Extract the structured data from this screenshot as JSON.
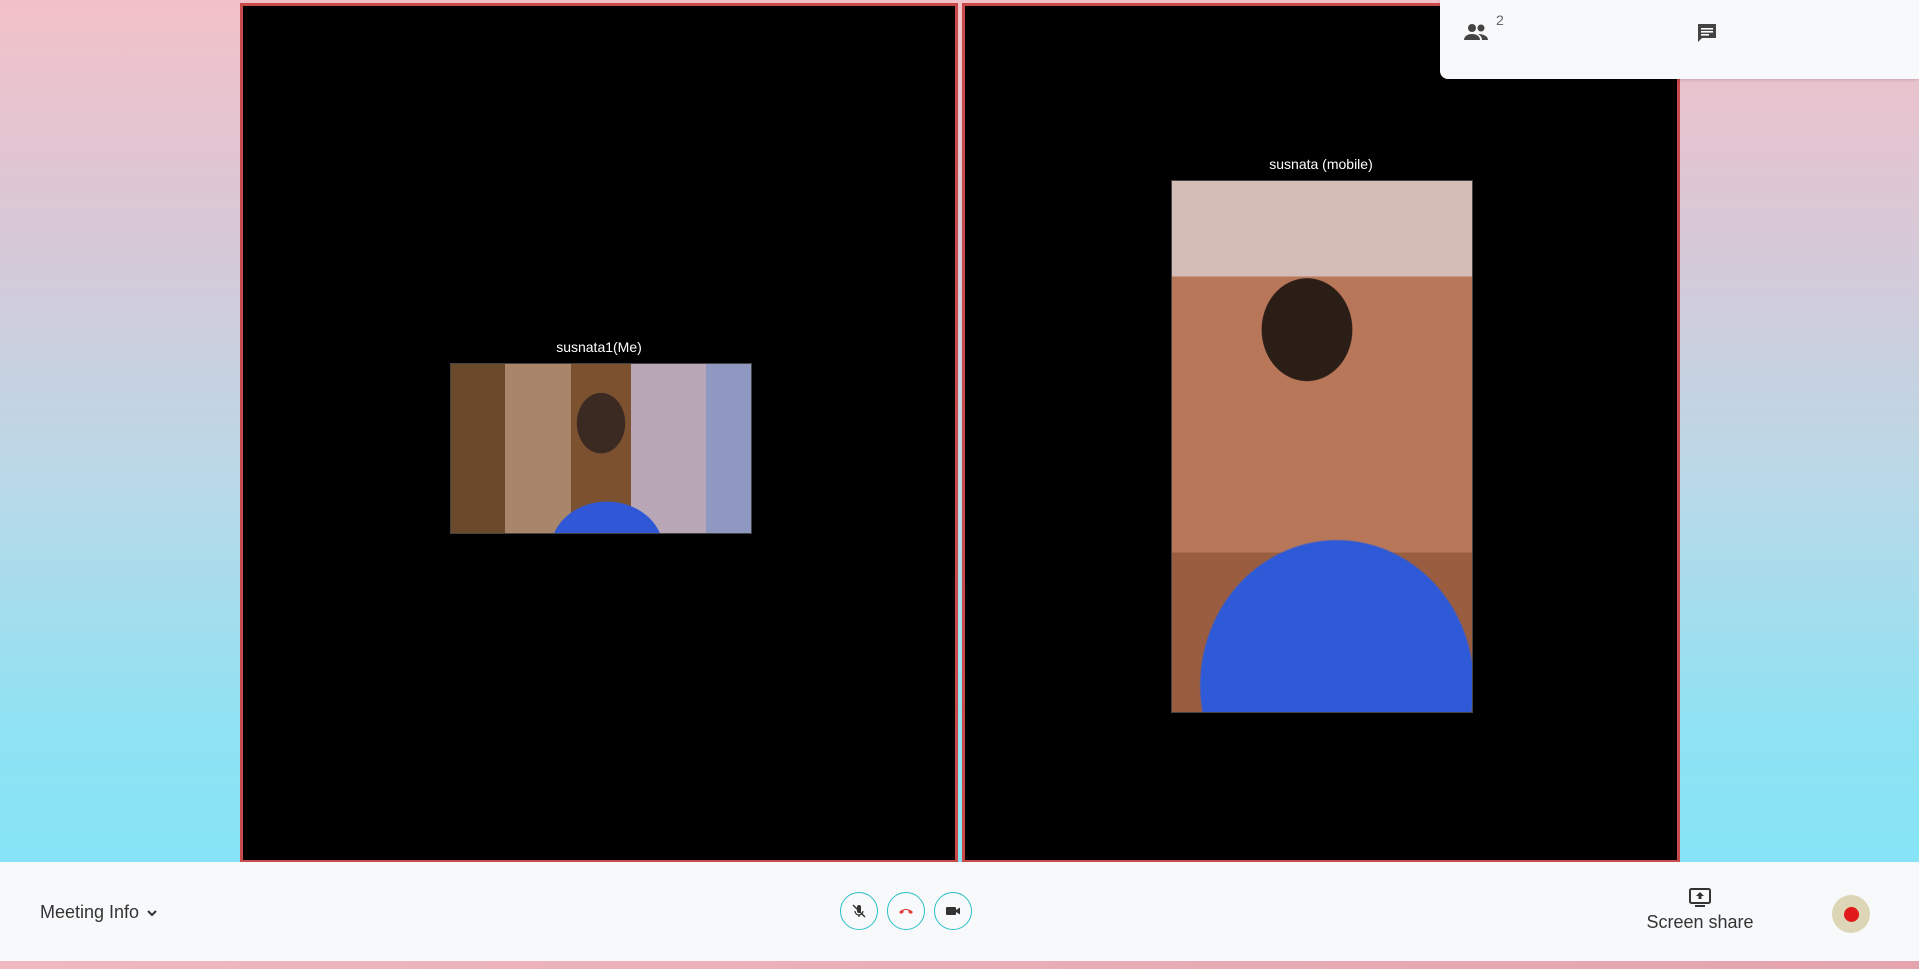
{
  "participants": [
    {
      "name": "susnata1(Me)"
    },
    {
      "name": "susnata (mobile)"
    }
  ],
  "top_panel": {
    "people_icon": "people-icon",
    "participant_count": "2",
    "chat_icon": "chat-icon"
  },
  "bottom_bar": {
    "meeting_info_label": "Meeting Info",
    "controls": {
      "mic_icon": "mic-off-icon",
      "hangup_icon": "phone-hangup-icon",
      "camera_icon": "video-camera-icon"
    },
    "screen_share_label": "Screen share",
    "record_icon": "record-icon"
  },
  "colors": {
    "tile_border": "#c94a4a",
    "control_ring": "#2bc0c8",
    "hangup": "#e53935",
    "record_dot": "#e11b1b"
  }
}
